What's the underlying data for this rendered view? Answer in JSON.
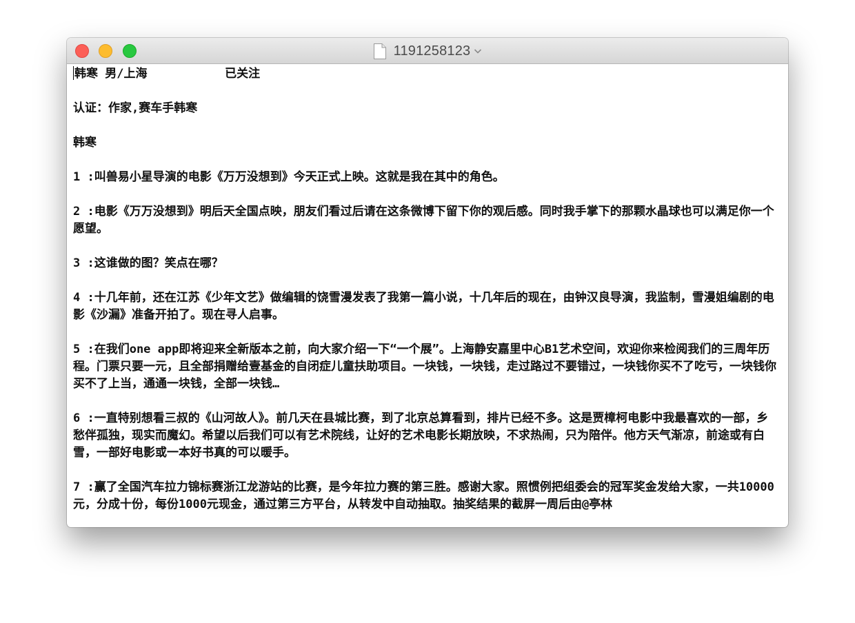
{
  "window": {
    "title": "1191258123"
  },
  "document": {
    "header_name": "韩寒 男/上海",
    "follow_status": "已关注",
    "verification": "认证：作家,赛车手韩寒",
    "name_line": "韩寒",
    "posts": [
      "1 :叫兽易小星导演的电影《万万没想到》今天正式上映。这就是我在其中的角色。",
      "2 :电影《万万没想到》明后天全国点映，朋友们看过后请在这条微博下留下你的观后感。同时我手掌下的那颗水晶球也可以满足你一个愿望。",
      "3 :这谁做的图？笑点在哪？",
      "4 :十几年前，还在江苏《少年文艺》做编辑的饶雪漫发表了我第一篇小说，十几年后的现在，由钟汉良导演，我监制，雪漫姐编剧的电影《沙漏》准备开拍了。现在寻人启事。",
      "5 :在我们one app即将迎来全新版本之前，向大家介绍一下“一个展”。上海静安嘉里中心B1艺术空间，欢迎你来检阅我们的三周年历程。门票只要一元，且全部捐赠给壹基金的自闭症儿童扶助项目。一块钱，一块钱，走过路过不要错过，一块钱你买不了吃亏，一块钱你买不了上当，通通一块钱，全部一块钱…",
      "6 :一直特别想看三叔的《山河故人》。前几天在县城比赛，到了北京总算看到，排片已经不多。这是贾樟柯电影中我最喜欢的一部，乡愁伴孤独，现实而魔幻。希望以后我们可以有艺术院线，让好的艺术电影长期放映，不求热闹，只为陪伴。他方天气渐凉，前途或有白雪，一部好电影或一本好书真的可以暖手。",
      "7 :赢了全国汽车拉力锦标赛浙江龙游站的比赛，是今年拉力赛的第三胜。感谢大家。照惯例把组委会的冠军奖金发给大家，一共10000元，分成十份，每份1000元现金，通过第三方平台，从转发中自动抽取。抽奖结果的截屏一周后由@亭林"
    ]
  },
  "icons": {
    "close": "close-button",
    "minimize": "minimize-button",
    "zoom": "zoom-button",
    "document": "document-icon",
    "title_menu": "chevron-down-icon"
  },
  "colors": {
    "close": "#fc5f57",
    "minimize": "#fdbc2e",
    "zoom": "#28c840"
  }
}
